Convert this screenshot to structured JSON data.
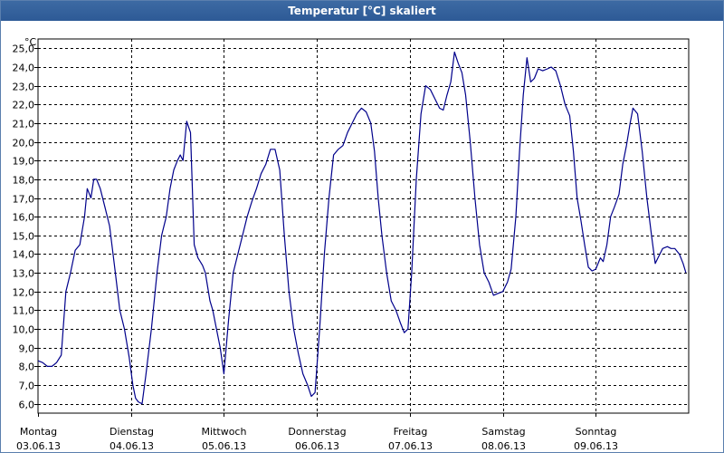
{
  "window": {
    "title": "Temperatur [°C] skaliert"
  },
  "chart_data": {
    "type": "line",
    "title": "Temperatur [°C] skaliert",
    "ylabel": "°C",
    "xlabel": "",
    "ylim": [
      5.5,
      25.5
    ],
    "xlim": [
      0,
      7
    ],
    "grid": true,
    "line_color": "#00008b",
    "y_ticks": [
      "6,0",
      "7,0",
      "8,0",
      "9,0",
      "10,0",
      "11,0",
      "12,0",
      "13,0",
      "14,0",
      "15,0",
      "16,0",
      "17,0",
      "18,0",
      "19,0",
      "20,0",
      "21,0",
      "22,0",
      "23,0",
      "24,0",
      "25,0"
    ],
    "x_ticks": [
      {
        "day": "Montag",
        "date": "03.06.13"
      },
      {
        "day": "Dienstag",
        "date": "04.06.13"
      },
      {
        "day": "Mittwoch",
        "date": "05.06.13"
      },
      {
        "day": "Donnerstag",
        "date": "06.06.13"
      },
      {
        "day": "Freitag",
        "date": "07.06.13"
      },
      {
        "day": "Samstag",
        "date": "08.06.13"
      },
      {
        "day": "Sonntag",
        "date": "09.06.13"
      }
    ],
    "series": [
      {
        "values": [
          [
            0.0,
            8.3
          ],
          [
            0.05,
            8.2
          ],
          [
            0.1,
            8.0
          ],
          [
            0.15,
            8.0
          ],
          [
            0.2,
            8.2
          ],
          [
            0.25,
            8.6
          ],
          [
            0.3,
            12.0
          ],
          [
            0.35,
            13.0
          ],
          [
            0.4,
            14.2
          ],
          [
            0.45,
            14.5
          ],
          [
            0.5,
            16.0
          ],
          [
            0.53,
            17.5
          ],
          [
            0.57,
            17.0
          ],
          [
            0.6,
            18.0
          ],
          [
            0.63,
            18.0
          ],
          [
            0.67,
            17.5
          ],
          [
            0.72,
            16.5
          ],
          [
            0.77,
            15.5
          ],
          [
            0.82,
            13.5
          ],
          [
            0.88,
            11.0
          ],
          [
            0.93,
            10.0
          ],
          [
            0.98,
            8.5
          ],
          [
            1.02,
            7.0
          ],
          [
            1.05,
            6.3
          ],
          [
            1.08,
            6.1
          ],
          [
            1.12,
            6.0
          ],
          [
            1.16,
            7.5
          ],
          [
            1.22,
            10.0
          ],
          [
            1.28,
            13.0
          ],
          [
            1.33,
            15.0
          ],
          [
            1.38,
            16.0
          ],
          [
            1.42,
            17.5
          ],
          [
            1.46,
            18.5
          ],
          [
            1.5,
            19.0
          ],
          [
            1.53,
            19.3
          ],
          [
            1.56,
            19.0
          ],
          [
            1.6,
            21.1
          ],
          [
            1.64,
            20.5
          ],
          [
            1.68,
            14.5
          ],
          [
            1.72,
            13.8
          ],
          [
            1.77,
            13.4
          ],
          [
            1.8,
            13.0
          ],
          [
            1.85,
            11.5
          ],
          [
            1.88,
            11.0
          ],
          [
            1.92,
            10.0
          ],
          [
            1.96,
            9.0
          ],
          [
            2.0,
            7.6
          ],
          [
            2.05,
            10.5
          ],
          [
            2.1,
            13.0
          ],
          [
            2.15,
            14.0
          ],
          [
            2.2,
            15.0
          ],
          [
            2.25,
            16.0
          ],
          [
            2.3,
            16.8
          ],
          [
            2.35,
            17.5
          ],
          [
            2.4,
            18.3
          ],
          [
            2.45,
            18.8
          ],
          [
            2.5,
            19.6
          ],
          [
            2.55,
            19.6
          ],
          [
            2.6,
            18.5
          ],
          [
            2.65,
            15.0
          ],
          [
            2.7,
            12.0
          ],
          [
            2.75,
            10.0
          ],
          [
            2.8,
            8.7
          ],
          [
            2.85,
            7.6
          ],
          [
            2.9,
            7.0
          ],
          [
            2.94,
            6.4
          ],
          [
            2.98,
            6.6
          ],
          [
            3.03,
            10.0
          ],
          [
            3.08,
            14.0
          ],
          [
            3.13,
            17.0
          ],
          [
            3.18,
            19.3
          ],
          [
            3.23,
            19.6
          ],
          [
            3.28,
            19.8
          ],
          [
            3.33,
            20.5
          ],
          [
            3.38,
            21.0
          ],
          [
            3.43,
            21.5
          ],
          [
            3.48,
            21.8
          ],
          [
            3.53,
            21.6
          ],
          [
            3.58,
            21.0
          ],
          [
            3.62,
            19.5
          ],
          [
            3.66,
            17.0
          ],
          [
            3.7,
            15.0
          ],
          [
            3.75,
            13.0
          ],
          [
            3.8,
            11.5
          ],
          [
            3.85,
            11.0
          ],
          [
            3.9,
            10.3
          ],
          [
            3.94,
            9.8
          ],
          [
            3.98,
            10.0
          ],
          [
            4.02,
            13.0
          ],
          [
            4.07,
            18.0
          ],
          [
            4.12,
            21.5
          ],
          [
            4.17,
            23.0
          ],
          [
            4.22,
            22.8
          ],
          [
            4.27,
            22.3
          ],
          [
            4.32,
            21.8
          ],
          [
            4.36,
            21.7
          ],
          [
            4.4,
            22.5
          ],
          [
            4.44,
            23.2
          ],
          [
            4.48,
            24.8
          ],
          [
            4.52,
            24.2
          ],
          [
            4.56,
            23.7
          ],
          [
            4.6,
            22.5
          ],
          [
            4.65,
            20.0
          ],
          [
            4.7,
            17.0
          ],
          [
            4.75,
            14.5
          ],
          [
            4.8,
            13.0
          ],
          [
            4.85,
            12.5
          ],
          [
            4.9,
            11.8
          ],
          [
            4.95,
            11.9
          ],
          [
            5.0,
            12.0
          ],
          [
            5.05,
            12.5
          ],
          [
            5.09,
            13.2
          ],
          [
            5.14,
            16.0
          ],
          [
            5.18,
            19.5
          ],
          [
            5.22,
            22.5
          ],
          [
            5.26,
            24.5
          ],
          [
            5.3,
            23.2
          ],
          [
            5.34,
            23.4
          ],
          [
            5.38,
            23.9
          ],
          [
            5.43,
            23.8
          ],
          [
            5.48,
            23.9
          ],
          [
            5.52,
            24.0
          ],
          [
            5.57,
            23.8
          ],
          [
            5.62,
            23.0
          ],
          [
            5.67,
            22.0
          ],
          [
            5.72,
            21.4
          ],
          [
            5.76,
            19.5
          ],
          [
            5.8,
            17.0
          ],
          [
            5.84,
            15.8
          ],
          [
            5.88,
            14.5
          ],
          [
            5.92,
            13.3
          ],
          [
            5.96,
            13.1
          ],
          [
            6.0,
            13.2
          ],
          [
            6.05,
            13.8
          ],
          [
            6.08,
            13.6
          ],
          [
            6.12,
            14.5
          ],
          [
            6.16,
            16.0
          ],
          [
            6.2,
            16.5
          ],
          [
            6.25,
            17.2
          ],
          [
            6.29,
            18.8
          ],
          [
            6.33,
            19.8
          ],
          [
            6.37,
            21.0
          ],
          [
            6.4,
            21.8
          ],
          [
            6.45,
            21.5
          ],
          [
            6.5,
            19.5
          ],
          [
            6.55,
            17.0
          ],
          [
            6.6,
            15.0
          ],
          [
            6.64,
            13.5
          ],
          [
            6.68,
            13.9
          ],
          [
            6.72,
            14.3
          ],
          [
            6.77,
            14.4
          ],
          [
            6.81,
            14.3
          ],
          [
            6.85,
            14.3
          ],
          [
            6.9,
            14.0
          ],
          [
            6.94,
            13.5
          ],
          [
            6.97,
            13.0
          ]
        ]
      }
    ]
  }
}
